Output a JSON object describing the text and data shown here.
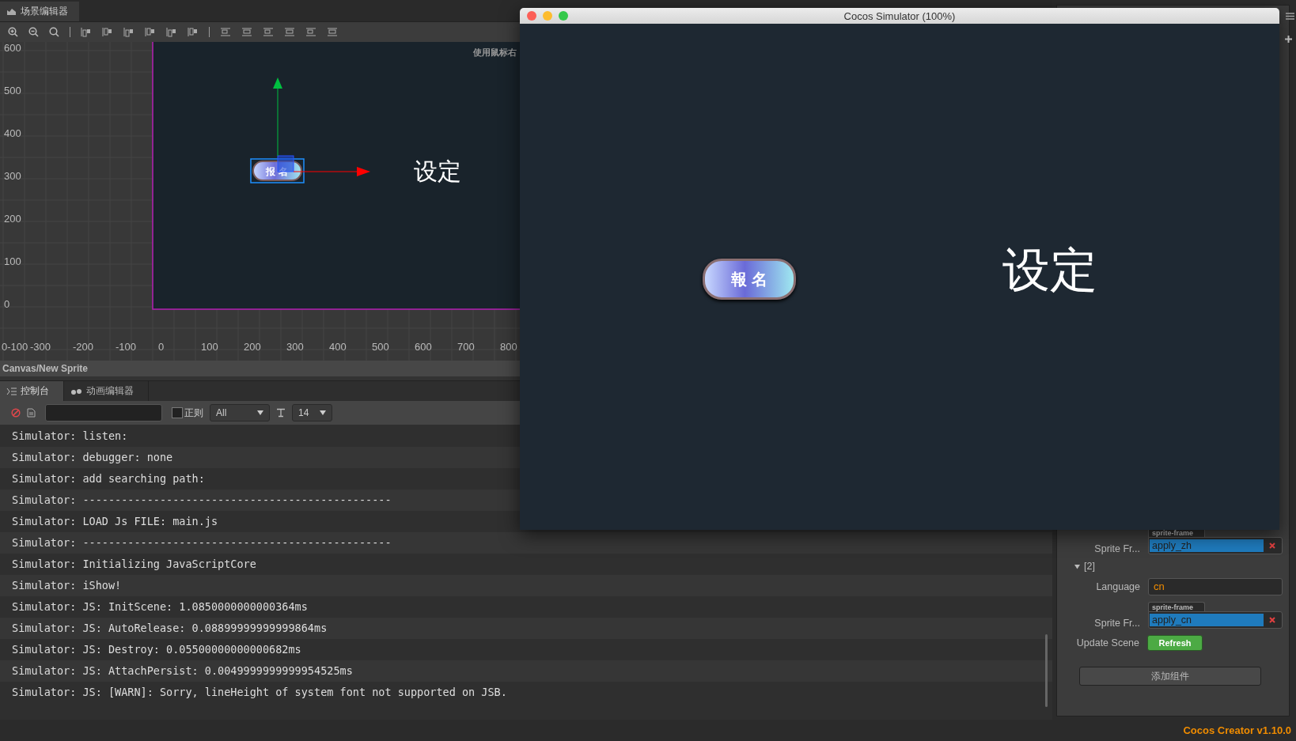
{
  "scene_editor": {
    "tab": "场景编辑器",
    "hint": "使用鼠标右",
    "y_labels": [
      "600",
      "500",
      "400",
      "300",
      "200",
      "100",
      "0"
    ],
    "x_labels": [
      "0-100",
      "-300",
      "-200",
      "-100",
      "0",
      "100",
      "200",
      "300",
      "400",
      "500",
      "600",
      "700",
      "800"
    ],
    "sprite_label": "报 名",
    "label": "设定",
    "breadcrumb": "Canvas/New Sprite"
  },
  "bottom_tabs": [
    {
      "label": "控制台",
      "selected": true
    },
    {
      "label": "动画编辑器",
      "selected": false
    }
  ],
  "console_toolbar": {
    "regex": {
      "label": "正则",
      "checked": false
    },
    "level": "All",
    "font_size": "14"
  },
  "logs": [
    "Simulator: listen:",
    "Simulator: debugger: none",
    "Simulator: add searching path:",
    "Simulator: ------------------------------------------------",
    "Simulator: LOAD Js FILE: main.js",
    "Simulator: ------------------------------------------------",
    "Simulator: Initializing JavaScriptCore",
    "Simulator: iShow!",
    "Simulator: JS: InitScene: 1.0850000000000364ms",
    "Simulator: JS: AutoRelease: 0.08899999999999864ms",
    "Simulator: JS: Destroy: 0.05500000000000682ms",
    "Simulator: JS: AttachPersist: 0.0049999999999954525ms",
    "Simulator: JS: [WARN]: Sorry, lineHeight of system font not supported on JSB."
  ],
  "inspector": {
    "rows": [
      {
        "kind": "sprite",
        "label": "Sprite Fr...",
        "tag": "sprite-frame",
        "value": "apply_zh"
      },
      {
        "kind": "group",
        "label": "[2]",
        "expanded": true
      },
      {
        "kind": "text",
        "label": "Language",
        "value": "cn"
      },
      {
        "kind": "sprite",
        "label": "Sprite Fr...",
        "tag": "sprite-frame",
        "value": "apply_cn"
      },
      {
        "kind": "button",
        "label": "Update Scene",
        "button": "Refresh"
      }
    ],
    "add_component": "添加组件"
  },
  "simulator": {
    "title": "Cocos Simulator (100%)",
    "sprite_label": "報 名",
    "label": "设定"
  },
  "status_bar": {
    "version": "Cocos Creator v1.10.0"
  }
}
